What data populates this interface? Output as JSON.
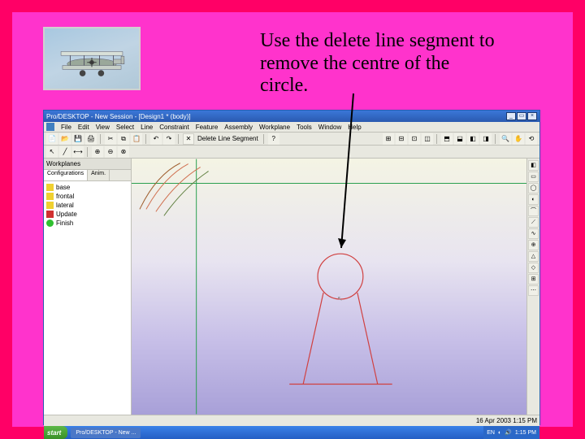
{
  "instruction_text": "Use the delete line segment to remove the centre of the circle.",
  "app": {
    "title": "Pro/DESKTOP - New Session - [Design1 * (body)]",
    "menus": [
      "File",
      "Edit",
      "View",
      "Select",
      "Line",
      "Constraint",
      "Feature",
      "Assembly",
      "Workplane",
      "Tools",
      "Window",
      "Help"
    ],
    "tool_label": "Delete Line Segment",
    "left_pane": {
      "header": "Workplanes",
      "tabs": [
        "Configurations",
        "Anim."
      ],
      "tree": [
        {
          "icon": "yellow",
          "label": "base"
        },
        {
          "icon": "yellow",
          "label": "frontal"
        },
        {
          "icon": "yellow",
          "label": "lateral"
        },
        {
          "icon": "red",
          "label": "Update"
        },
        {
          "icon": "green",
          "label": "Finish"
        }
      ]
    },
    "right_tools": [
      "◧",
      "▭",
      "◯",
      "◐",
      "⌒",
      "⟋",
      "∿",
      "⊕",
      "△",
      "◇",
      "⊞",
      "⋯"
    ],
    "status_right": "16 Apr 2003  1:15 PM"
  },
  "taskbar": {
    "start": "start",
    "items": [
      "Pro/DESKTOP - New ..."
    ],
    "tray_lang": "EN",
    "tray_time": "1:15 PM"
  }
}
